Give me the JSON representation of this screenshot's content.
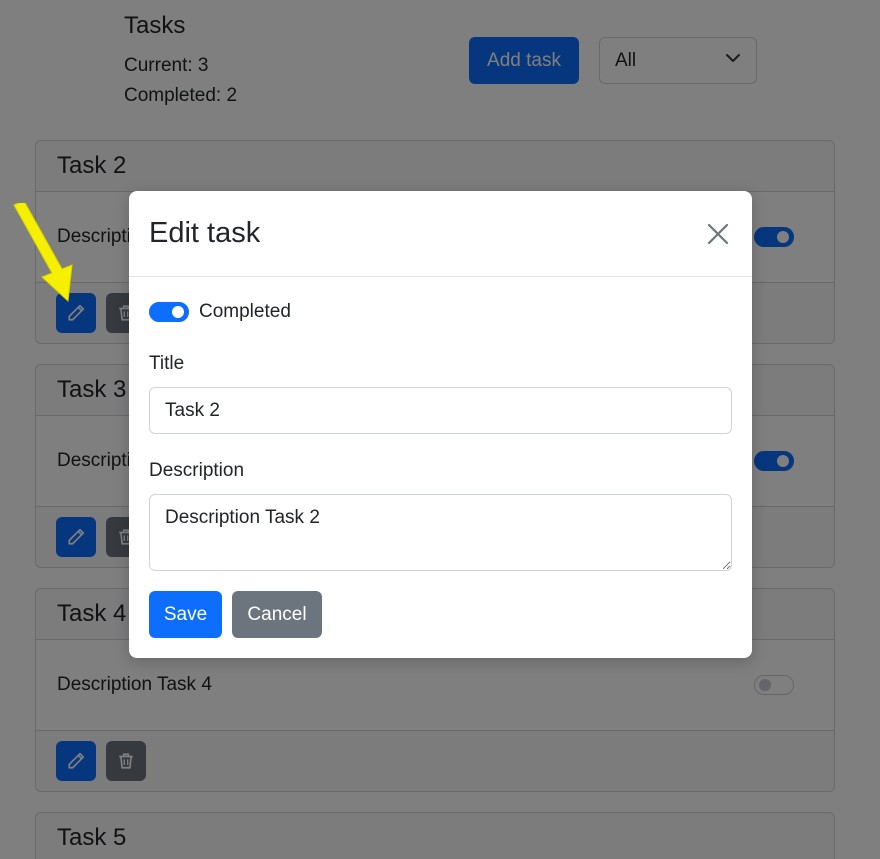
{
  "header": {
    "title": "Tasks",
    "current": "Current: 3",
    "completed": "Completed: 2",
    "add_task_label": "Add task",
    "filter_selected": "All"
  },
  "tasks": [
    {
      "title": "Task 2",
      "description": "Description Task 2",
      "completed": true
    },
    {
      "title": "Task 3",
      "description": "Description Task 3",
      "completed": true
    },
    {
      "title": "Task 4",
      "description": "Description Task 4",
      "completed": false
    },
    {
      "title": "Task 5",
      "description": "",
      "completed": false
    }
  ],
  "modal": {
    "title": "Edit task",
    "completed_label": "Completed",
    "completed": true,
    "title_label": "Title",
    "title_value": "Task 2",
    "description_label": "Description",
    "description_value": "Description Task 2",
    "save_label": "Save",
    "cancel_label": "Cancel"
  },
  "icons": {
    "edit": "pencil-icon",
    "delete": "trash-icon",
    "close": "close-icon",
    "dropdown": "chevron-down-icon",
    "pointer": "arrow-pointer-icon"
  },
  "colors": {
    "primary": "#0d6efd",
    "secondary": "#6c757d",
    "backdrop": "rgba(0,0,0,0.5)",
    "arrow": "#f5f000"
  }
}
